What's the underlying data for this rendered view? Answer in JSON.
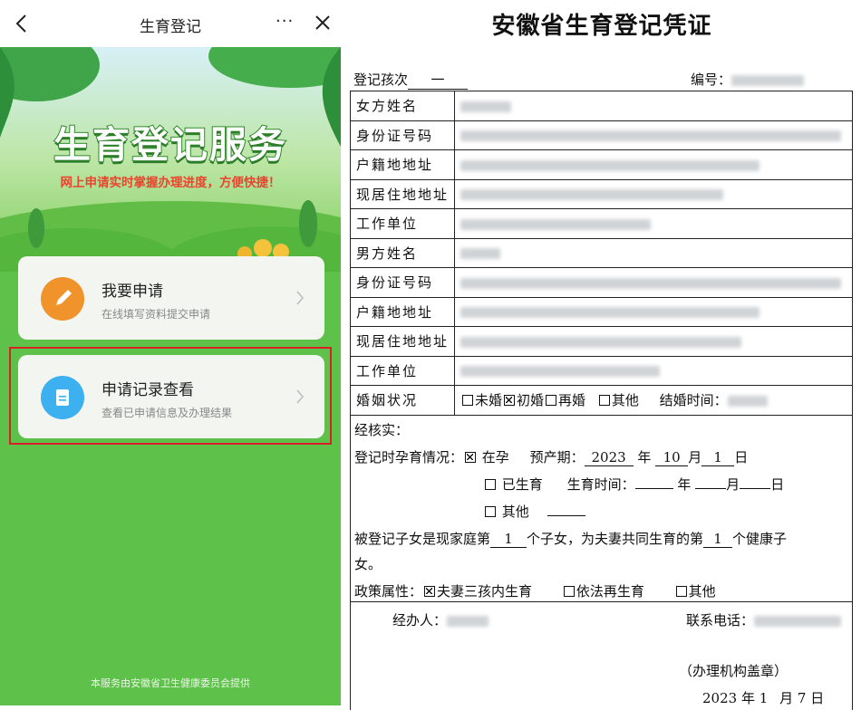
{
  "header": {
    "title": "生育登记",
    "more": "···"
  },
  "banner": {
    "title": "生育登记服务",
    "subtitle": "网上申请实时掌握办理进度，方便快捷！"
  },
  "cards": [
    {
      "title": "我要申请",
      "desc": "在线填写资料提交申请",
      "icon": "pencil-icon",
      "color": "#f0932b"
    },
    {
      "title": "申请记录查看",
      "desc": "查看已申请信息及办理结果",
      "icon": "document-icon",
      "color": "#3db0f0"
    }
  ],
  "footer": "本服务由安徽省卫生健康委员会提供",
  "certificate": {
    "title": "安徽省生育登记凭证",
    "reg_label": "登记孩次",
    "reg_value": "一",
    "no_label": "编号：",
    "rows": [
      {
        "label": "女方姓名"
      },
      {
        "label": "身份证号码"
      },
      {
        "label": "户籍地地址"
      },
      {
        "label": "现居住地地址"
      },
      {
        "label": "工作单位"
      },
      {
        "label": "男方姓名"
      },
      {
        "label": "身份证号码"
      },
      {
        "label": "户籍地地址"
      },
      {
        "label": "现居住地地址"
      },
      {
        "label": "工作单位"
      }
    ],
    "marital": {
      "label": "婚姻状况",
      "options": [
        "未婚",
        "初婚",
        "再婚",
        "其他"
      ],
      "checked": "初婚",
      "marry_time_label": "结婚时间："
    },
    "verified": "经核实：",
    "pregnancy_label": "登记时孕育情况：",
    "opt_pregnant": "在孕",
    "due_label": "预产期：",
    "due_year": "2023",
    "due_month": "10",
    "due_day": "1",
    "opt_born": "已生育",
    "birth_time_label": "生育时间：",
    "opt_other": "其他",
    "year": "年",
    "month": "月",
    "day": "日",
    "child_line": {
      "pre": "被登记子女是现家庭第",
      "n1": "1",
      "mid": "个子女，为夫妻共同生育的第",
      "n2": "1",
      "post": "个健康子",
      "tail": "女。"
    },
    "policy": {
      "label": "政策属性：",
      "options": [
        "夫妻三孩内生育",
        "依法再生育",
        "其他"
      ],
      "checked": "夫妻三孩内生育"
    },
    "handler_label": "经办人：",
    "phone_label": "联系电话：",
    "seal": "（办理机构盖章）",
    "date": {
      "y": "2023",
      "m": "1",
      "d": "7"
    }
  }
}
